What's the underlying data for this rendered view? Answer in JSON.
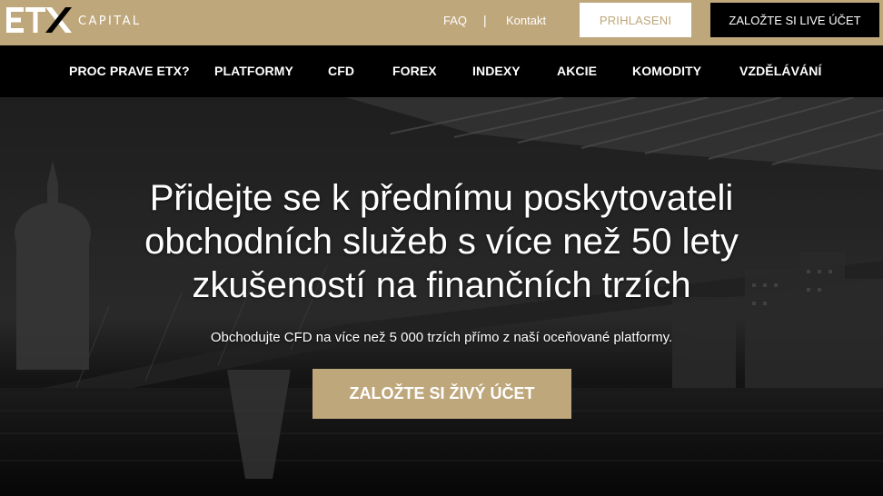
{
  "brand": {
    "logo_text": "ETX",
    "logo_caption": "CAPITAL",
    "gold": "#bfa77c"
  },
  "header": {
    "faq": "FAQ",
    "separator": "|",
    "contact": "Kontakt",
    "login": "PRIHLASENI",
    "live_account": "ZALOŽTE SI LIVE ÚČET"
  },
  "nav": {
    "items": [
      "PROC PRAVE ETX?",
      "PLATFORMY",
      "CFD",
      "FOREX",
      "INDEXY",
      "AKCIE",
      "KOMODITY",
      "VZDĚLÁVÁNÍ"
    ]
  },
  "hero": {
    "title_lines": [
      "Přidejte se k přednímu poskytovateli",
      "obchodních služeb s více než 50 lety",
      "zkušeností na finančních trzích"
    ],
    "subtitle": "Obchodujte CFD na více než 5 000 trzích přímo z naší oceňované platformy.",
    "cta": "ZALOŽTE SI ŽIVÝ ÚČET"
  }
}
